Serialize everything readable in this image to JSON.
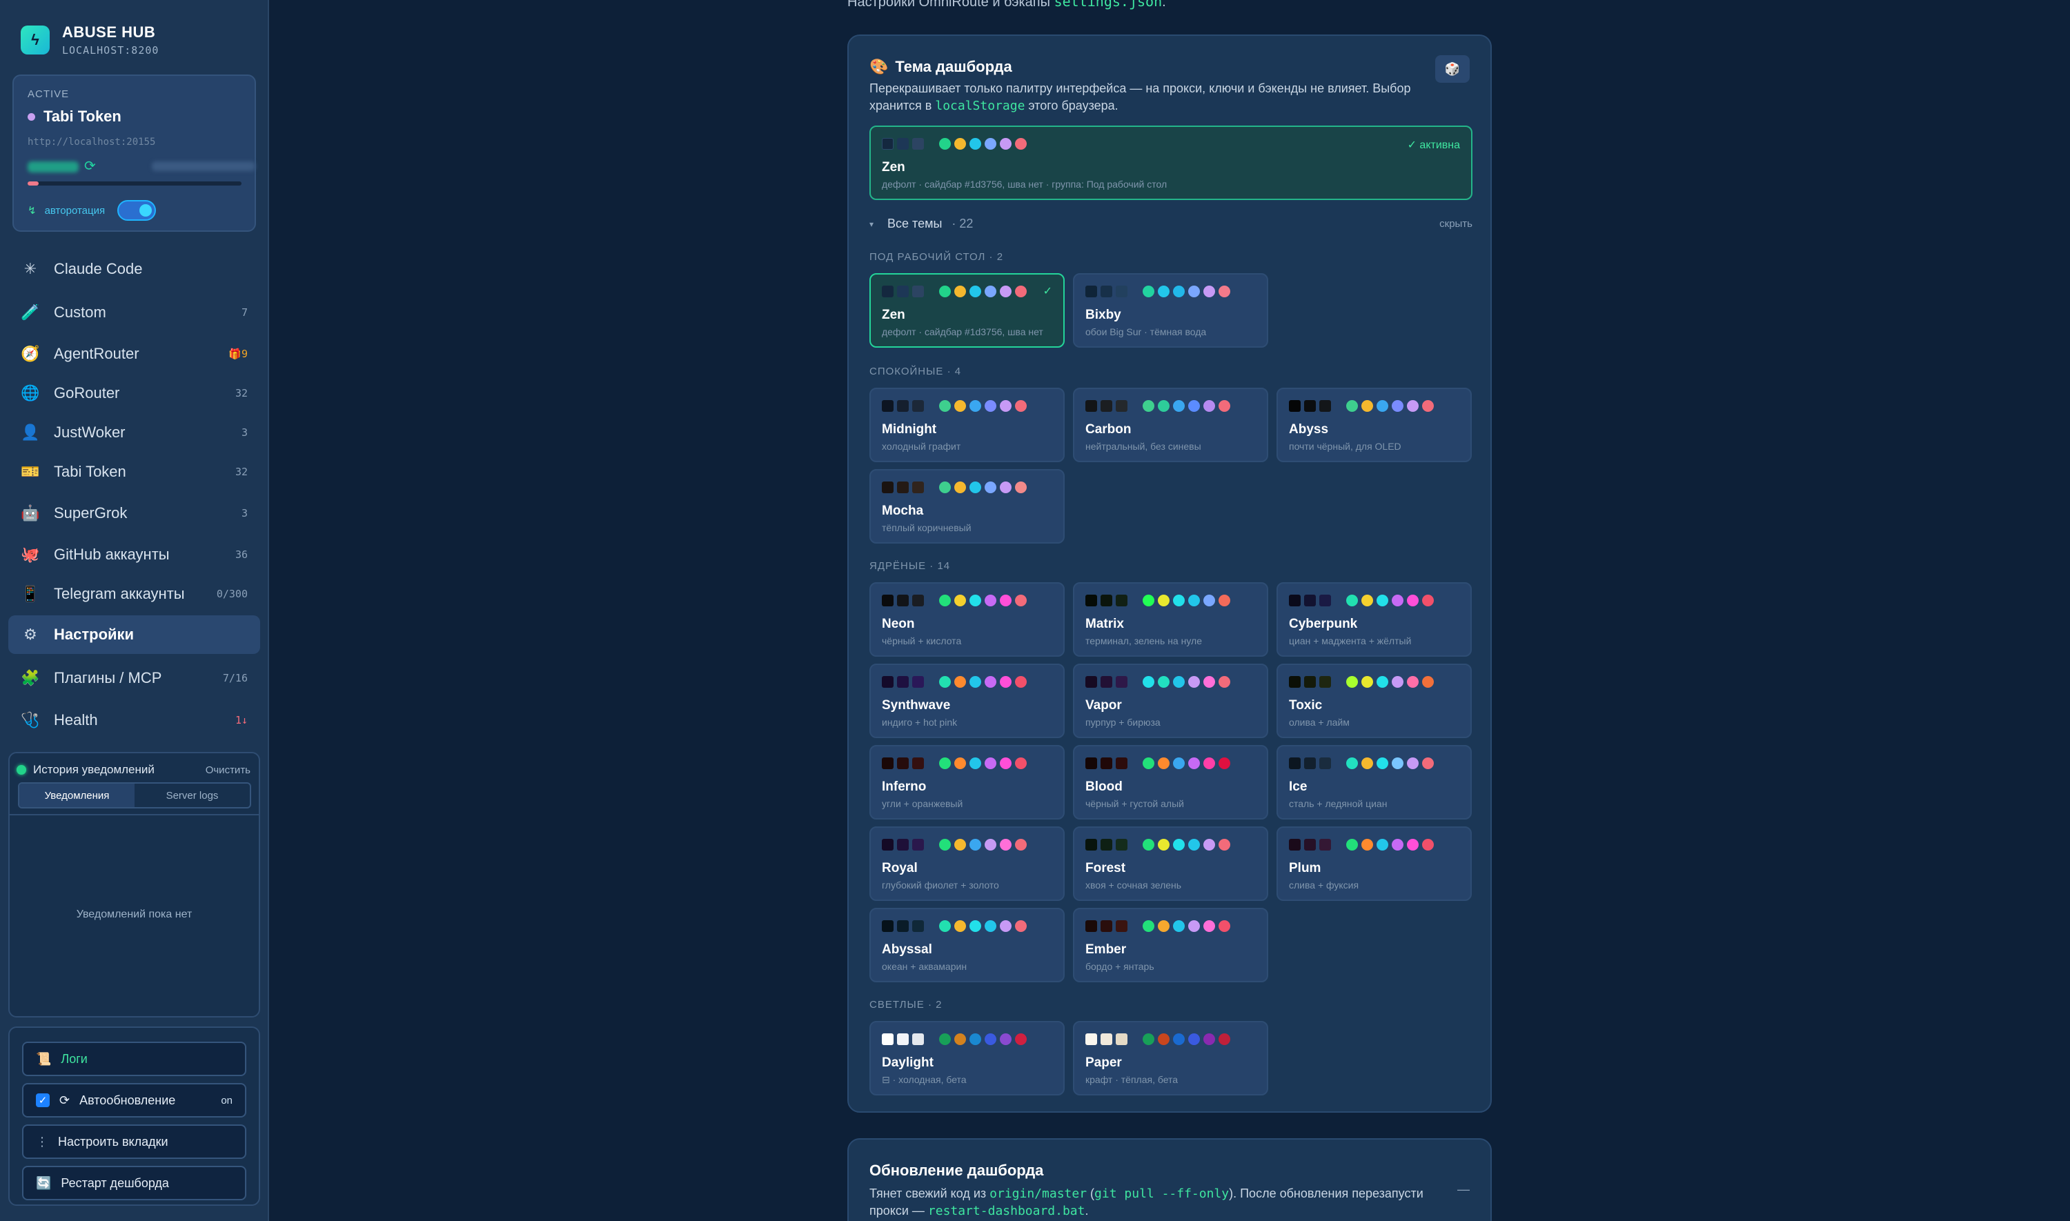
{
  "brand": {
    "title": "ABUSE HUB",
    "subtitle": "LOCALHOST:8200",
    "logo_icon": "bolt-icon"
  },
  "active_account": {
    "label": "ACTIVE",
    "name": "Tabi Token",
    "url": "http://localhost:20155",
    "usage_fraction": 0.05,
    "autorotation_label": "авторотация",
    "autorotation_on": true
  },
  "nav": [
    {
      "icon": "✳",
      "label": "Claude Code",
      "count": ""
    },
    {
      "icon": "🧪",
      "label": "Custom",
      "count": "7"
    },
    {
      "icon": "🧭",
      "label": "AgentRouter",
      "count": "🎁9"
    },
    {
      "icon": "🌐",
      "label": "GoRouter",
      "count": "32"
    },
    {
      "icon": "👤",
      "label": "JustWoker",
      "count": "3"
    },
    {
      "icon": "🎫",
      "label": "Tabi Token",
      "count": "32"
    },
    {
      "icon": "🤖",
      "label": "SuperGrok",
      "count": "3"
    },
    {
      "icon": "🐙",
      "label": "GitHub аккаунты",
      "count": "36"
    },
    {
      "icon": "📱",
      "label": "Telegram аккаунты",
      "count": "0/300"
    },
    {
      "icon": "⚙",
      "label": "Настройки",
      "count": ""
    },
    {
      "icon": "🧩",
      "label": "Плагины / MCP",
      "count": "7/16"
    },
    {
      "icon": "🩺",
      "label": "Health",
      "count": "1↓"
    }
  ],
  "notifications": {
    "title": "История уведомлений",
    "clear": "Очистить",
    "tab_notifications": "Уведомления",
    "tab_logs": "Server logs",
    "empty": "Уведомлений пока нет"
  },
  "actions": {
    "logs": "Логи",
    "autoupdate": "Автообновление",
    "autoupdate_state": "on",
    "configure_tabs": "Настроить вкладки",
    "restart": "Рестарт дешборда"
  },
  "top_text": {
    "prefix": "Настройки OmniRoute и бэкапы ",
    "code": "settings.json",
    "suffix": "."
  },
  "theme_panel": {
    "title": "Тема дашборда",
    "desc_prefix": "Перекрашивает только палитру интерфейса — на прокси, ключи и бэкенды не влияет. Выбор хранится в ",
    "desc_code": "localStorage",
    "desc_suffix": " этого браузера.",
    "active_tag": "✓ активна",
    "active_theme": {
      "name": "Zen",
      "desc": "дефолт · сайдбар #1d3756, шва нет · группа: Под рабочий стол"
    },
    "all_themes": "Все темы",
    "all_count": "22",
    "hide": "скрыть",
    "groups": {
      "desktop": "ПОД РАБОЧИЙ СТОЛ · 2",
      "calm": "СПОКОЙНЫЕ · 4",
      "bold": "ЯДРЁНЫЕ · 14",
      "light": "СВЕТЛЫЕ · 2"
    },
    "themes": {
      "zen": {
        "name": "Zen",
        "desc": "дефолт · сайдбар #1d3756, шва нет"
      },
      "bixby": {
        "name": "Bixby",
        "desc": "обои Big Sur · тёмная вода"
      },
      "midnight": {
        "name": "Midnight",
        "desc": "холодный графит"
      },
      "carbon": {
        "name": "Carbon",
        "desc": "нейтральный, без синевы"
      },
      "abyss": {
        "name": "Abyss",
        "desc": "почти чёрный, для OLED"
      },
      "mocha": {
        "name": "Mocha",
        "desc": "тёплый коричневый"
      },
      "neon": {
        "name": "Neon",
        "desc": "чёрный + кислота"
      },
      "matrix": {
        "name": "Matrix",
        "desc": "терминал, зелень на нуле"
      },
      "cyberpunk": {
        "name": "Cyberpunk",
        "desc": "циан + маджента + жёлтый"
      },
      "synthwave": {
        "name": "Synthwave",
        "desc": "индиго + hot pink"
      },
      "vapor": {
        "name": "Vapor",
        "desc": "пурпур + бирюза"
      },
      "toxic": {
        "name": "Toxic",
        "desc": "олива + лайм"
      },
      "inferno": {
        "name": "Inferno",
        "desc": "угли + оранжевый"
      },
      "blood": {
        "name": "Blood",
        "desc": "чёрный + густой алый"
      },
      "ice": {
        "name": "Ice",
        "desc": "сталь + ледяной циан"
      },
      "royal": {
        "name": "Royal",
        "desc": "глубокий фиолет + золото"
      },
      "forest": {
        "name": "Forest",
        "desc": "хвоя + сочная зелень"
      },
      "plum": {
        "name": "Plum",
        "desc": "слива + фуксия"
      },
      "abyssal": {
        "name": "Abyssal",
        "desc": "океан + аквамарин"
      },
      "ember": {
        "name": "Ember",
        "desc": "бордо + янтарь"
      },
      "daylight": {
        "name": "Daylight",
        "desc": "⊟ · холодная, бета"
      },
      "paper": {
        "name": "Paper",
        "desc": "крафт · тёплая, бета"
      }
    }
  },
  "update_panel": {
    "title": "Обновление дашборда",
    "desc1": "Тянет свежий код из ",
    "code1": "origin/master",
    "desc2": " (",
    "code2": "git pull --ff-only",
    "desc3": "). После обновления перезапусти прокси — ",
    "code3": "restart-dashboard.bat",
    "desc4": ".",
    "collapse": "—"
  }
}
